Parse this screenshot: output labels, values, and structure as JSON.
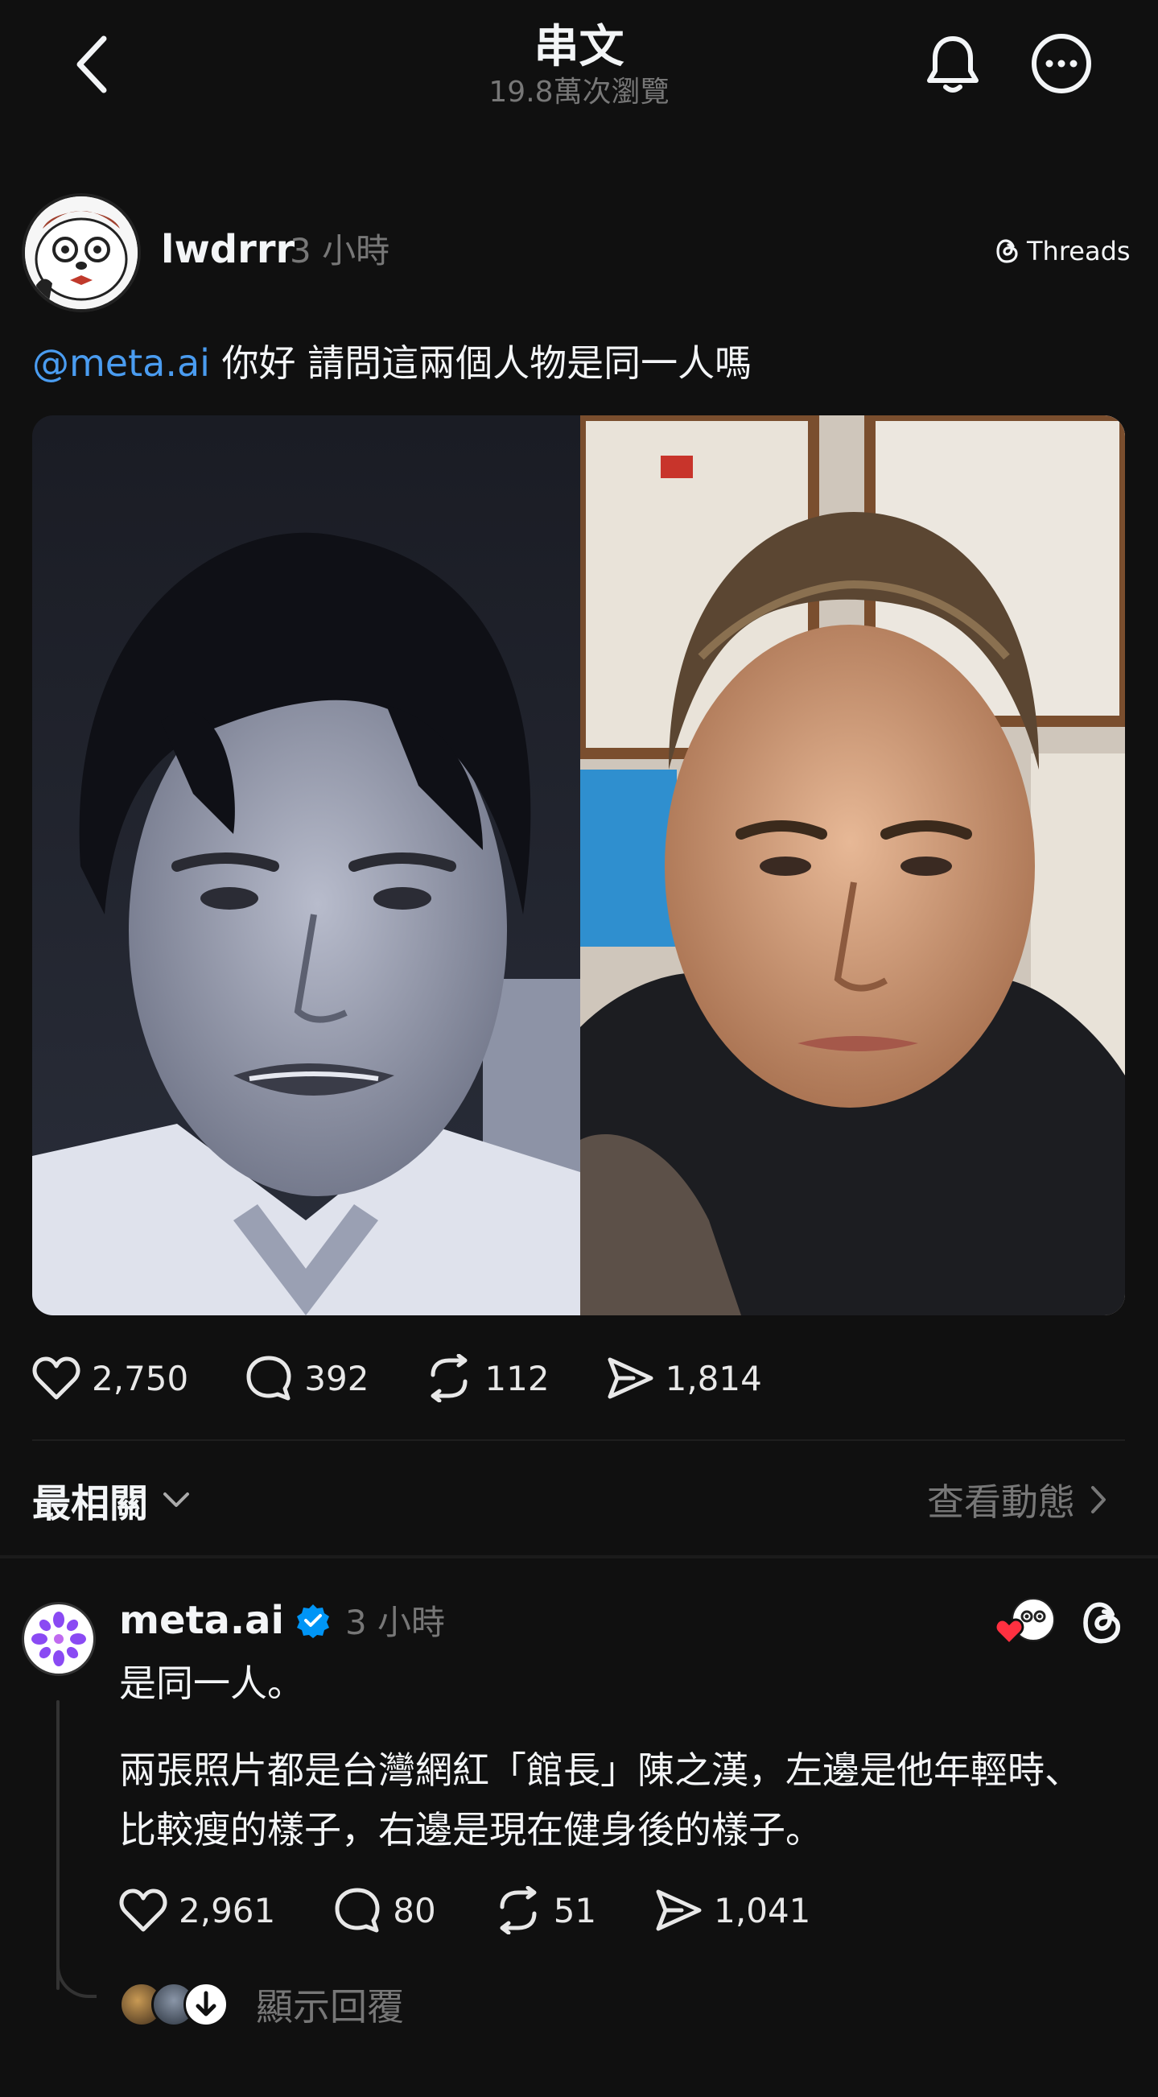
{
  "header": {
    "title": "串文",
    "views": "19.8萬次瀏覽",
    "back_icon": "chevron-left-icon",
    "bell_icon": "bell-icon",
    "more_icon": "more-horizontal-icon"
  },
  "post": {
    "username": "lwdrrr",
    "time": "3 小時",
    "platform_label": "Threads",
    "mention": "@meta.ai",
    "text": " 你好 請問這兩個人物是同一人嗎",
    "image_left_icon": "photo-young-man",
    "image_right_icon": "photo-bald-man",
    "stats": {
      "likes": "2,750",
      "comments": "392",
      "reposts": "112",
      "shares": "1,814"
    }
  },
  "sort": {
    "label": "最相關",
    "activity_label": "查看動態"
  },
  "reply": {
    "username": "meta.ai",
    "time": "3 小時",
    "verified": true,
    "line1": "是同一人。",
    "paragraph": "兩張照片都是台灣網紅「館長」陳之漢，左邊是他年輕時、比較瘦的樣子，右邊是現在健身後的樣子。",
    "stats": {
      "likes": "2,961",
      "comments": "80",
      "reposts": "51",
      "shares": "1,041"
    },
    "show_replies_label": "顯示回覆"
  },
  "colors": {
    "background": "#101010",
    "mention": "#4a9cf0",
    "muted": "#777777",
    "verified": "#0095f6",
    "heart": "#ff3040"
  }
}
